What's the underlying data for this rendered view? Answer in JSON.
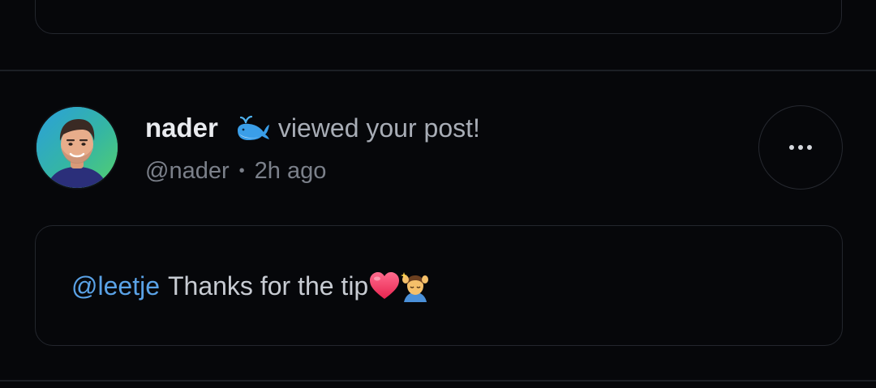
{
  "notification": {
    "username": "nader",
    "whale_emoji": "🐳",
    "action_text": "viewed your post!",
    "handle": "@nader",
    "separator": "•",
    "time_ago": "2h ago",
    "more_icon": "more-horizontal-icon"
  },
  "comment": {
    "mention": "@leetje",
    "text": "Thanks for the tip",
    "emojis": [
      "❤️",
      "💆‍♂️"
    ]
  },
  "colors": {
    "background": "#06070a",
    "mention": "#5aa2e6",
    "border": "#23262d"
  }
}
